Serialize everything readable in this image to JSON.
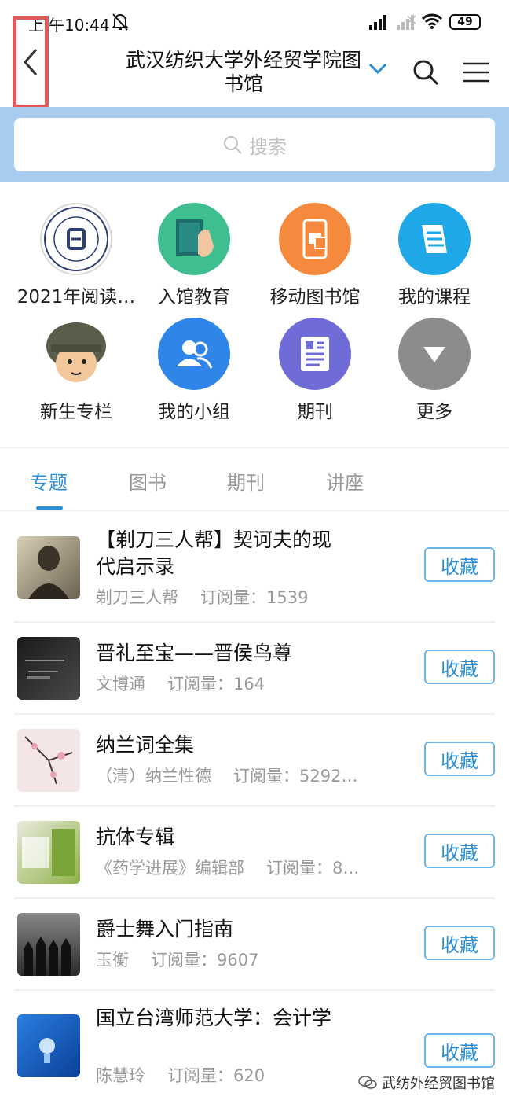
{
  "status_bar": {
    "time_prefix": "上",
    "time": "午10:44",
    "battery": "49",
    "icons": [
      "bell-mute-icon",
      "signal-icon",
      "signal-weak-icon",
      "wifi-icon",
      "battery-icon"
    ]
  },
  "header": {
    "title": "武汉纺织大学外经贸学院图书馆",
    "icons": [
      "back-icon",
      "chevron-down-icon",
      "search-icon",
      "menu-icon"
    ]
  },
  "search": {
    "placeholder": "搜索"
  },
  "quick_links": [
    {
      "label": "2021年阅读…",
      "icon": "university-seal-icon",
      "color": "#ffffff"
    },
    {
      "label": "入馆教育",
      "icon": "book-hand-icon",
      "color": "#3fbf8f"
    },
    {
      "label": "移动图书馆",
      "icon": "mobile-library-icon",
      "color": "#f5893d"
    },
    {
      "label": "我的课程",
      "icon": "course-icon",
      "color": "#1ea8e8"
    },
    {
      "label": "新生专栏",
      "icon": "soldier-avatar-icon",
      "color": "#ffffff"
    },
    {
      "label": "我的小组",
      "icon": "group-icon",
      "color": "#2f86e8"
    },
    {
      "label": "期刊",
      "icon": "journal-icon",
      "color": "#6f6cd8"
    },
    {
      "label": "更多",
      "icon": "more-arrow-icon",
      "color": "#8c8c8c"
    }
  ],
  "tabs": [
    {
      "label": "专题",
      "active": true
    },
    {
      "label": "图书",
      "active": false
    },
    {
      "label": "期刊",
      "active": false
    },
    {
      "label": "讲座",
      "active": false
    }
  ],
  "subscribe_label": "订阅量：",
  "fav_label": "收藏",
  "items": [
    {
      "title": "【剃刀三人帮】契诃夫的现代启示录",
      "author": "剃刀三人帮",
      "subs": "1539",
      "thumb": "chekhov-portrait-thumb"
    },
    {
      "title": "晋礼至宝——晋侯鸟尊",
      "author": "文博通",
      "subs": "164",
      "thumb": "bronze-bird-thumb"
    },
    {
      "title": "纳兰词全集",
      "author": "（清）纳兰性德",
      "subs": "5292…",
      "thumb": "plum-blossom-thumb"
    },
    {
      "title": "抗体专辑",
      "author": "《药学进展》编辑部",
      "subs": "8…",
      "thumb": "pharmacy-books-thumb"
    },
    {
      "title": "爵士舞入门指南",
      "author": "玉衡",
      "subs": "9607",
      "thumb": "dancers-silhouette-thumb"
    },
    {
      "title": "国立台湾师范大学：会计学",
      "author": "陈慧玲",
      "subs": "620",
      "thumb": "lightbulb-blue-thumb"
    }
  ],
  "watermark": "武纺外经贸图书馆"
}
